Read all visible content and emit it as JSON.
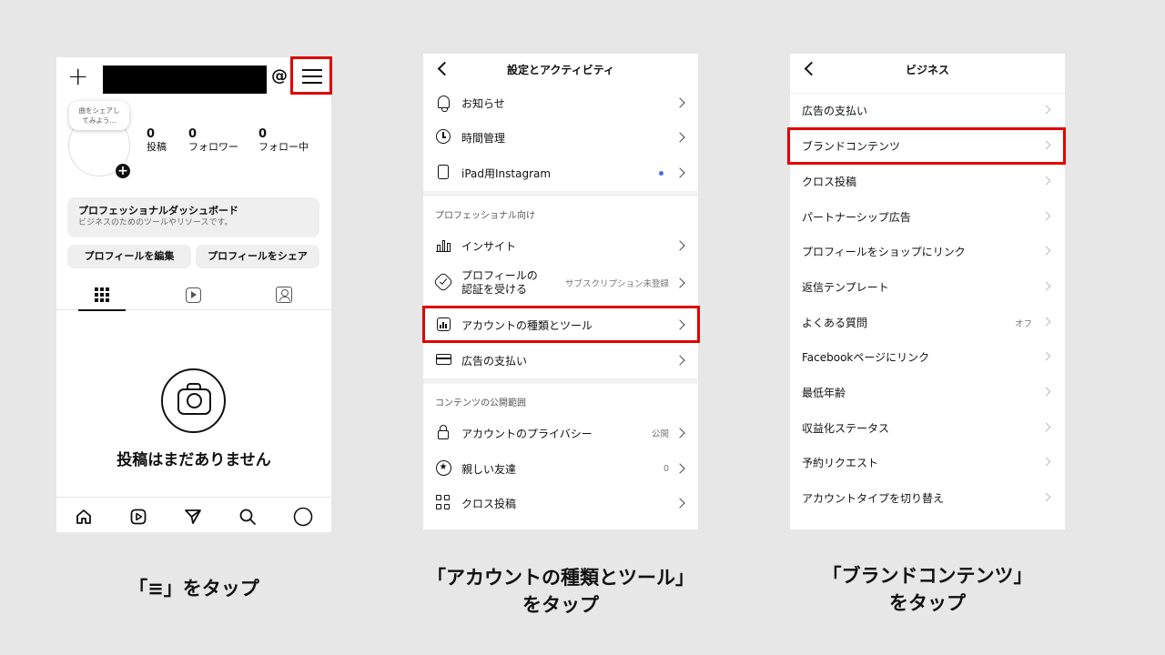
{
  "panel1": {
    "plus_icon": "+",
    "bubble_text": "曲をシェアし\nてみよう...",
    "avatar_plus": "+",
    "stats": [
      {
        "num": "0",
        "label": "投稿"
      },
      {
        "num": "0",
        "label": "フォロワー"
      },
      {
        "num": "0",
        "label": "フォロー中"
      }
    ],
    "dashboard_title": "プロフェッショナルダッシュボード",
    "dashboard_sub": "ビジネスのためのツールやリソースです。",
    "edit_profile": "プロフィールを編集",
    "share_profile": "プロフィールをシェア",
    "no_posts": "投稿はまだありません",
    "threads_icon": "@"
  },
  "panel2": {
    "title": "設定とアクティビティ",
    "rows_top": [
      {
        "label": "お知らせ",
        "icon": "bell-icon"
      },
      {
        "label": "時間管理",
        "icon": "clock-icon"
      },
      {
        "label": "iPad用Instagram",
        "icon": "ipad-icon"
      }
    ],
    "section_pro": "プロフェッショナル向け",
    "insight": "インサイト",
    "verify_line1": "プロフィールの",
    "verify_line2": "認証を受ける",
    "verify_value": "サブスクリプション未登録",
    "account_tools": "アカウントの種類とツール",
    "ad_payments": "広告の支払い",
    "section_content": "コンテンツの公開範囲",
    "privacy": "アカウントのプライバシー",
    "privacy_value": "公開",
    "close_friends": "親しい友達",
    "close_friends_value": "0",
    "cross_post": "クロス投稿"
  },
  "panel3": {
    "title": "ビジネス",
    "rows": [
      {
        "label": "広告の支払い",
        "value": ""
      },
      {
        "label": "ブランドコンテンツ",
        "value": ""
      },
      {
        "label": "クロス投稿",
        "value": ""
      },
      {
        "label": "パートナーシップ広告",
        "value": ""
      },
      {
        "label": "プロフィールをショップにリンク",
        "value": ""
      },
      {
        "label": "返信テンプレート",
        "value": ""
      },
      {
        "label": "よくある質問",
        "value": "オフ"
      },
      {
        "label": "Facebookページにリンク",
        "value": ""
      },
      {
        "label": "最低年齢",
        "value": ""
      },
      {
        "label": "収益化ステータス",
        "value": ""
      },
      {
        "label": "予約リクエスト",
        "value": ""
      },
      {
        "label": "アカウントタイプを切り替え",
        "value": ""
      }
    ]
  },
  "captions": {
    "c1": "「≡」をタップ",
    "c2_line1": "「アカウントの種類とツール」",
    "c2_line2": "をタップ",
    "c3_line1": "「ブランドコンテンツ」",
    "c3_line2": "をタップ"
  },
  "colors": {
    "highlight": "#e00000",
    "background": "#e7e7e7",
    "dot": "#4a6cf7"
  }
}
